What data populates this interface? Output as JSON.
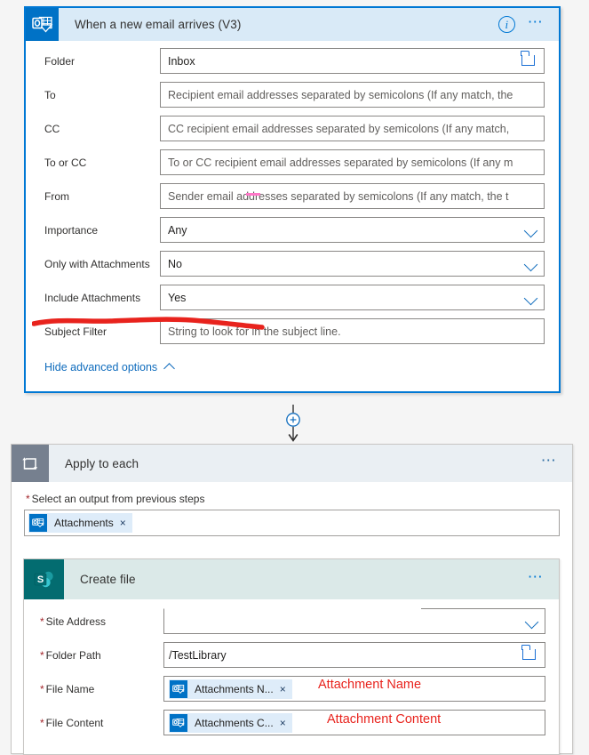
{
  "trigger": {
    "title": "When a new email arrives (V3)",
    "icon": "outlook-icon",
    "info_icon": "info-icon",
    "more_icon": "ellipsis-icon",
    "accent": "#0078d4",
    "header_bg": "#d9eaf7",
    "fields": [
      {
        "label": "Folder",
        "value": "Inbox",
        "is_placeholder": false,
        "control": "text-with-folder-picker"
      },
      {
        "label": "To",
        "value": "Recipient email addresses separated by semicolons (If any match, the",
        "is_placeholder": true,
        "control": "text"
      },
      {
        "label": "CC",
        "value": "CC recipient email addresses separated by semicolons (If any match,",
        "is_placeholder": true,
        "control": "text"
      },
      {
        "label": "To or CC",
        "value": "To or CC recipient email addresses separated by semicolons (If any m",
        "is_placeholder": true,
        "control": "text"
      },
      {
        "label": "From",
        "value": "Sender email addresses separated by semicolons (If any match, the t",
        "is_placeholder": true,
        "control": "text"
      },
      {
        "label": "Importance",
        "value": "Any",
        "is_placeholder": false,
        "control": "dropdown"
      },
      {
        "label": "Only with Attachments",
        "value": "No",
        "is_placeholder": false,
        "control": "dropdown"
      },
      {
        "label": "Include Attachments",
        "value": "Yes",
        "is_placeholder": false,
        "control": "dropdown"
      },
      {
        "label": "Subject Filter",
        "value": "String to look for in the subject line.",
        "is_placeholder": true,
        "control": "text"
      }
    ],
    "advanced_options_label": "Hide advanced options"
  },
  "connector": {
    "add_step_icon": "plus-circle-icon",
    "arrow_icon": "arrow-down-icon"
  },
  "scope": {
    "title": "Apply to each",
    "icon": "loop-icon",
    "more_icon": "ellipsis-icon",
    "header_bg": "#eaeff3",
    "input_label": "Select an output from previous steps",
    "required_marker": "*",
    "token": {
      "text": "Attachments",
      "icon": "outlook-icon",
      "remove_icon": "close-icon",
      "remove_glyph": "×"
    }
  },
  "create_file": {
    "title": "Create file",
    "icon": "sharepoint-icon",
    "more_icon": "ellipsis-icon",
    "header_bg": "#dbe9e8",
    "accent": "#036c70",
    "required_marker": "*",
    "fields": [
      {
        "label": "Site Address",
        "control": "dropdown",
        "value": "",
        "is_placeholder": false
      },
      {
        "label": "Folder Path",
        "control": "text-with-folder-picker",
        "value": "/TestLibrary",
        "is_placeholder": false
      },
      {
        "label": "File Name",
        "control": "token",
        "token_text": "Attachments N...",
        "token_icon": "outlook-icon",
        "remove_glyph": "×"
      },
      {
        "label": "File Content",
        "control": "token",
        "token_text": "Attachments C...",
        "token_icon": "outlook-icon",
        "remove_glyph": "×"
      }
    ]
  },
  "annotations": {
    "color": "#e8231d",
    "items": [
      {
        "text": "Attachment Name",
        "kind": "text-label",
        "target": "File Name token"
      },
      {
        "text": "Attachment Content",
        "kind": "text-label",
        "target": "File Content token"
      },
      {
        "text": "",
        "kind": "underline",
        "target": "Include Attachments row"
      }
    ]
  }
}
